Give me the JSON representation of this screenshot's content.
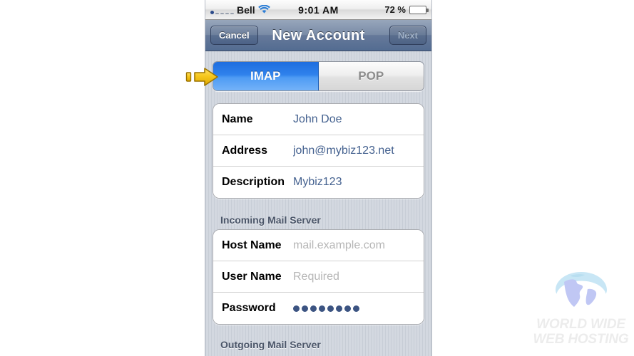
{
  "status_bar": {
    "carrier": "Bell",
    "signal_icon": "signal-dots-icon",
    "wifi_icon": "wifi-icon",
    "time": "9:01 AM",
    "battery_percent": "72 %",
    "battery_icon": "battery-icon",
    "battery_level": 72
  },
  "nav_bar": {
    "cancel_label": "Cancel",
    "title": "New Account",
    "next_label": "Next"
  },
  "segmented_control": {
    "options": [
      {
        "label": "IMAP",
        "selected": true
      },
      {
        "label": "POP",
        "selected": false
      }
    ]
  },
  "account_group": {
    "rows": [
      {
        "label": "Name",
        "value": "John Doe",
        "is_placeholder": false
      },
      {
        "label": "Address",
        "value": "john@mybiz123.net",
        "is_placeholder": false
      },
      {
        "label": "Description",
        "value": "Mybiz123",
        "is_placeholder": false
      }
    ]
  },
  "incoming_section": {
    "header": "Incoming Mail Server",
    "rows": [
      {
        "label": "Host Name",
        "value": "mail.example.com",
        "is_placeholder": true
      },
      {
        "label": "User Name",
        "value": "Required",
        "is_placeholder": true
      },
      {
        "label": "Password",
        "value": "",
        "is_placeholder": false,
        "is_password": true,
        "dot_count": 8
      }
    ]
  },
  "outgoing_section": {
    "header": "Outgoing Mail Server"
  },
  "annotation": {
    "arrow_icon": "right-arrow-annotation-icon",
    "points_at": "IMAP"
  },
  "watermark": {
    "globe_icon": "globe-icon",
    "line1": "WORLD WIDE",
    "line2": "WEB HOSTING"
  },
  "colors": {
    "accent_blue": "#2f82ec",
    "nav_bar_blue": "#66799a",
    "value_text": "#44618f",
    "placeholder_text": "#b6b6b6",
    "arrow_yellow": "#f5c316",
    "battery_green": "#4fc12a"
  }
}
